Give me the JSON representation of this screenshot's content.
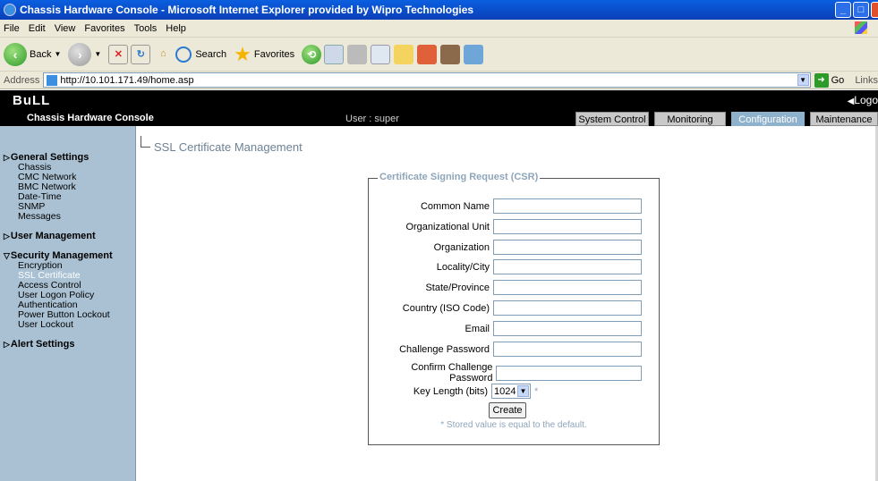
{
  "window": {
    "title": "Chassis Hardware Console - Microsoft Internet Explorer provided by Wipro Technologies"
  },
  "menu": [
    "File",
    "Edit",
    "View",
    "Favorites",
    "Tools",
    "Help"
  ],
  "toolbar": {
    "back": "Back",
    "search": "Search",
    "favorites": "Favorites"
  },
  "address": {
    "label": "Address",
    "url": "http://10.101.171.49/home.asp",
    "go": "Go",
    "links": "Links"
  },
  "app": {
    "logo": "BuLL",
    "logout": "Logo",
    "name": "Chassis Hardware Console",
    "user": "User : super",
    "tabs": [
      "System Control",
      "Monitoring",
      "Configuration",
      "Maintenance"
    ],
    "active_tab": "Configuration"
  },
  "sidebar": {
    "groups": [
      {
        "label": "General Settings",
        "items": [
          "Chassis",
          "CMC Network",
          "BMC Network",
          "Date-Time",
          "SNMP",
          "Messages"
        ]
      },
      {
        "label": "User Management",
        "items": []
      },
      {
        "label": "Security Management",
        "items": [
          "Encryption",
          "SSL Certificate",
          "Access Control",
          "User Logon Policy",
          "Authentication",
          "Power Button Lockout",
          "User Lockout"
        ],
        "selected": "SSL Certificate"
      },
      {
        "label": "Alert Settings",
        "items": []
      }
    ]
  },
  "page": {
    "title": "SSL Certificate Management",
    "legend": "Certificate Signing Request (CSR)",
    "fields": [
      {
        "label": "Common Name",
        "value": ""
      },
      {
        "label": "Organizational Unit",
        "value": ""
      },
      {
        "label": "Organization",
        "value": ""
      },
      {
        "label": "Locality/City",
        "value": ""
      },
      {
        "label": "State/Province",
        "value": ""
      },
      {
        "label": "Country (ISO Code)",
        "value": ""
      },
      {
        "label": "Email",
        "value": ""
      },
      {
        "label": "Challenge Password",
        "value": ""
      },
      {
        "label": "Confirm Challenge Password",
        "value": ""
      }
    ],
    "key_length": {
      "label": "Key Length (bits)",
      "value": "1024",
      "marker": "*"
    },
    "create_label": "Create",
    "note": "* Stored value is equal to the default."
  }
}
